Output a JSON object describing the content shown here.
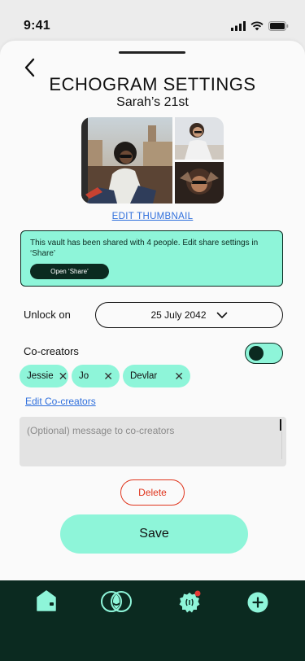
{
  "status_bar": {
    "time": "9:41"
  },
  "header": {
    "title": "ECHOGRAM SETTINGS",
    "subtitle": "Sarah’s 21st"
  },
  "thumbnail": {
    "edit_label": "EDIT THUMBNAIL"
  },
  "share_notice": {
    "text": "This vault has been shared with 4 people. Edit share settings in ‘Share’",
    "button_label": "Open ‘Share’"
  },
  "unlock": {
    "label": "Unlock on",
    "date": "25 July 2042"
  },
  "cocreators": {
    "label": "Co-creators",
    "toggle_on": true,
    "chips": [
      {
        "name": "Jessie"
      },
      {
        "name": "Jo"
      },
      {
        "name": "Devlar"
      }
    ],
    "edit_label": "Edit Co-creators"
  },
  "message": {
    "placeholder": "(Optional) message to co-creators",
    "value": ""
  },
  "actions": {
    "delete_label": "Delete",
    "save_label": "Save"
  },
  "bottom_nav": {
    "items": [
      {
        "icon": "home-icon"
      },
      {
        "icon": "echogram-icon"
      },
      {
        "icon": "notification-badge-icon",
        "has_badge": true
      },
      {
        "icon": "add-icon"
      }
    ]
  },
  "colors": {
    "accent": "#8ef5d9",
    "dark": "#0b2a20",
    "link": "#2f6fdc",
    "danger": "#e0341c",
    "badge": "#e53935"
  }
}
